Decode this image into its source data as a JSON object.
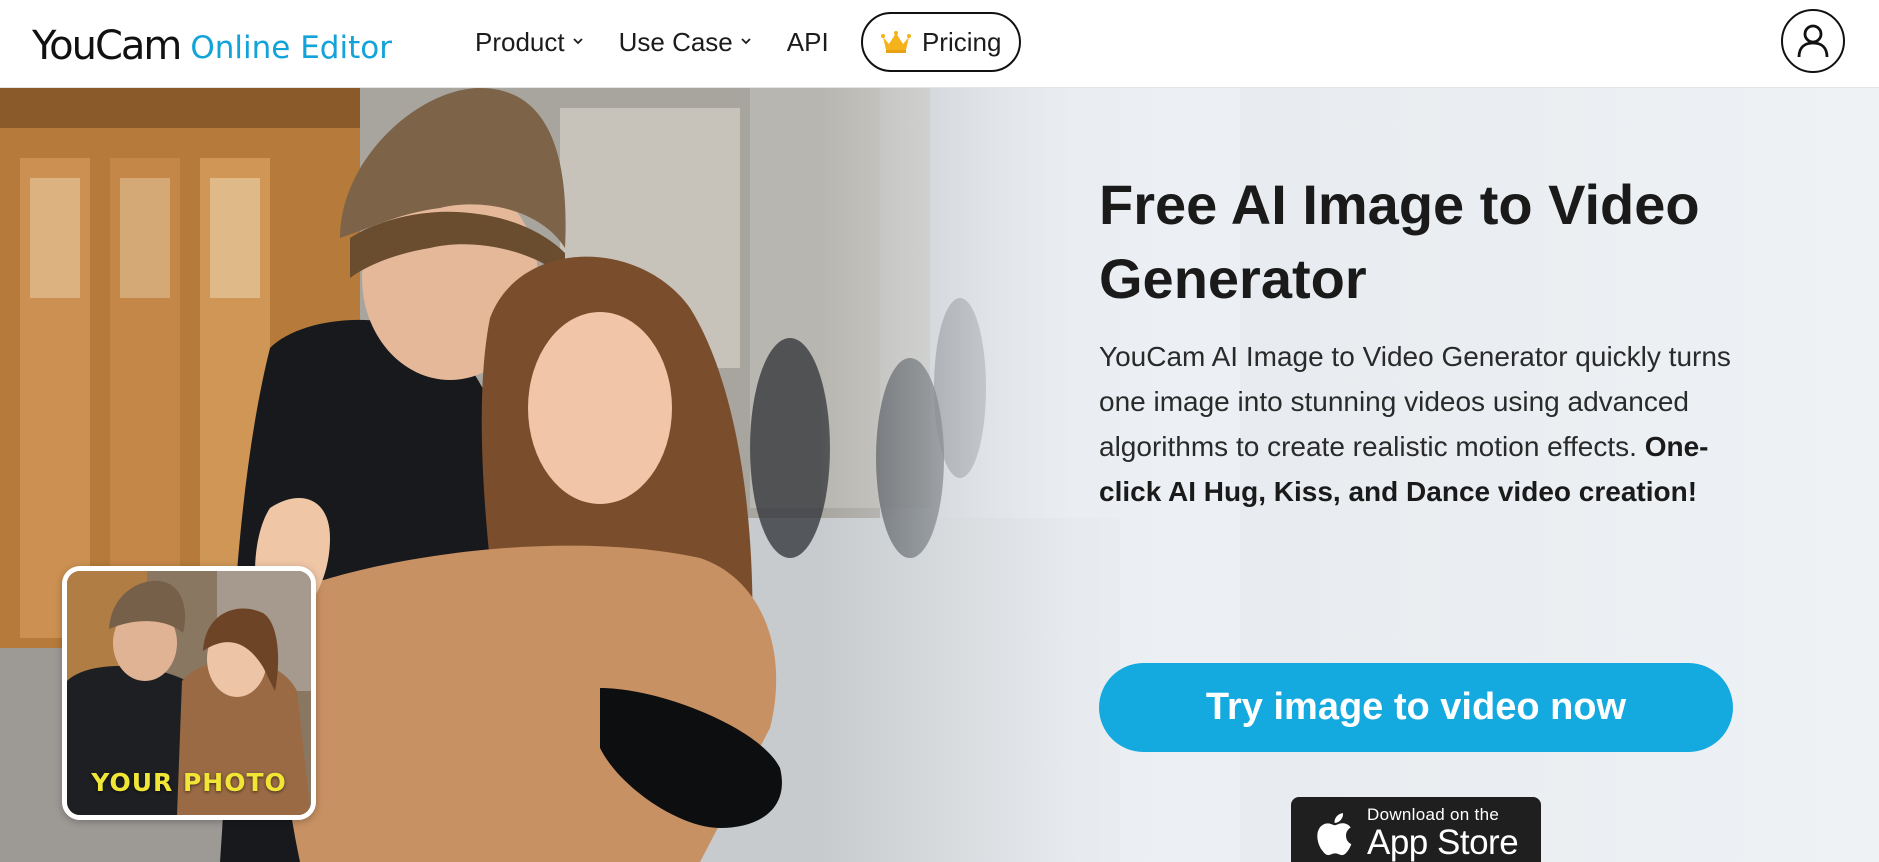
{
  "brand": {
    "logo_main": "YouCam",
    "logo_sub": "Online Editor",
    "accent": "#12a3d8"
  },
  "nav": {
    "items": [
      {
        "label": "Product",
        "has_dropdown": true
      },
      {
        "label": "Use Case",
        "has_dropdown": true
      },
      {
        "label": "API",
        "has_dropdown": false
      }
    ],
    "pricing_label": "Pricing",
    "pricing_icon": "crown-icon",
    "account_icon": "user-icon"
  },
  "hero": {
    "title": "Free AI Image to Video Generator",
    "description": "YouCam AI Image to Video Generator quickly turns one image into stunning videos using advanced algorithms to create realistic motion effects.",
    "description_bold": "One-click AI Hug, Kiss, and Dance video creation!",
    "cta_label": "Try image to video now",
    "cta_color": "#14a9df",
    "thumbnail_label": "YOUR PHOTO",
    "thumbnail_label_color": "#f1e635",
    "app_store": {
      "small": "Download on the",
      "big": "App Store",
      "icon": "apple-icon"
    }
  }
}
